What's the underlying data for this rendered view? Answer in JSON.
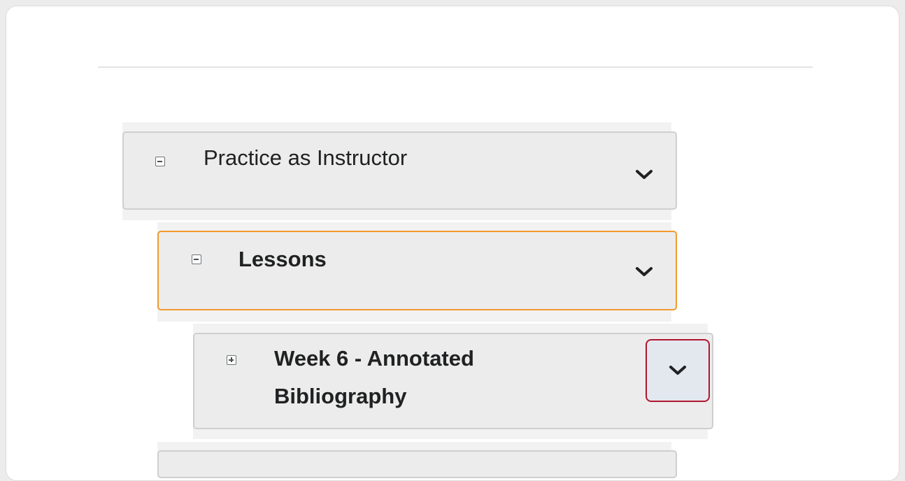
{
  "tree": {
    "nodes": [
      {
        "label": "Practice as Instructor",
        "expanded": true,
        "level": 0
      },
      {
        "label": "Lessons",
        "expanded": true,
        "level": 1,
        "focused": true
      },
      {
        "label": "Week 6 - Annotated",
        "label_line2": "Bibliography",
        "expanded": false,
        "level": 2
      }
    ]
  },
  "colors": {
    "focus_border": "#f29a2e",
    "highlight_border": "#b0172f",
    "node_background": "#ececec"
  },
  "icons": {
    "collapse": "minus-box-icon",
    "expand": "plus-box-icon",
    "menu": "chevron-down-icon"
  }
}
